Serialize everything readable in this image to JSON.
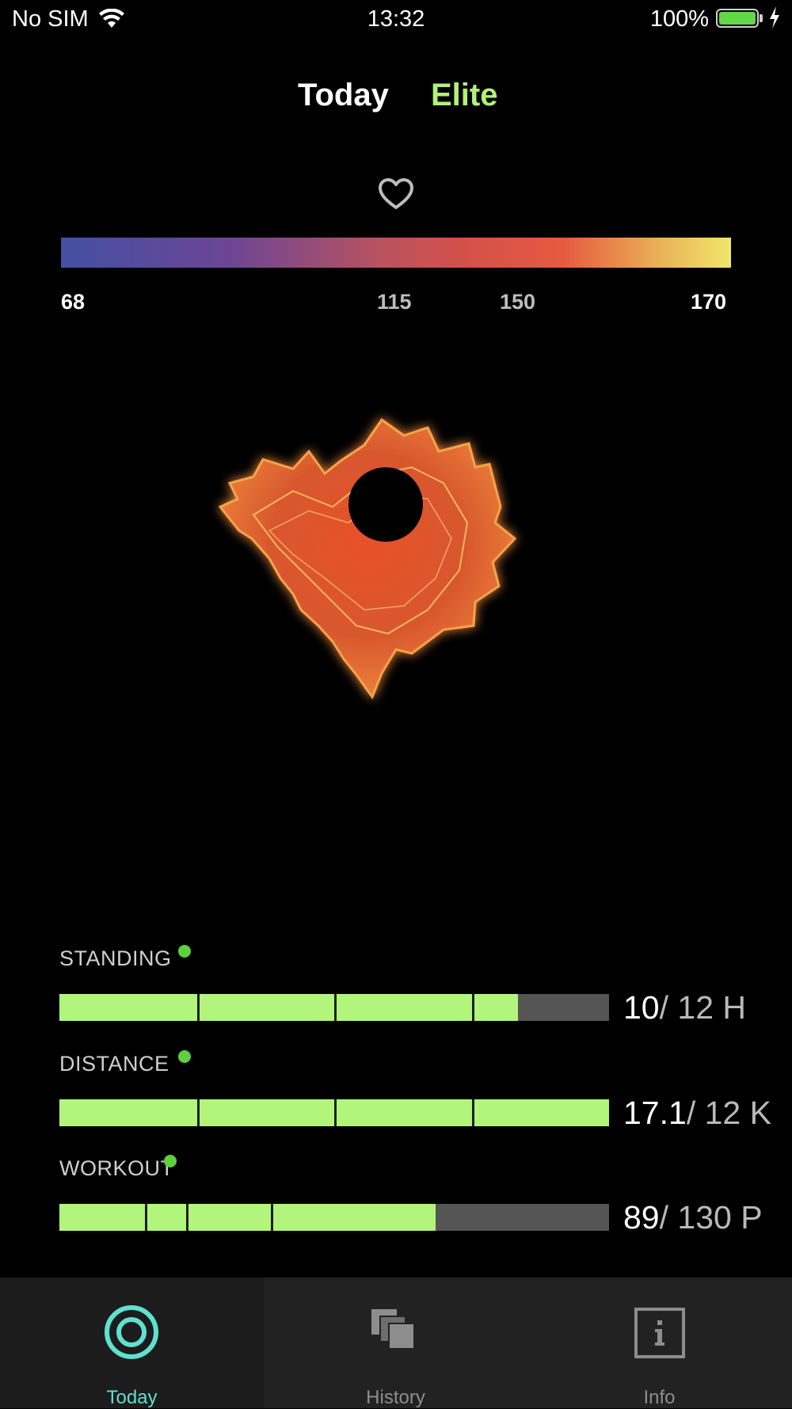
{
  "status_bar": {
    "carrier": "No SIM",
    "time": "13:32",
    "battery_percent": "100%",
    "battery_level": 1.0,
    "battery_color": "#63d64a"
  },
  "header": {
    "tabs": [
      {
        "label": "Today",
        "active": true
      },
      {
        "label": "Elite",
        "active": false,
        "color": "#b1f27a"
      }
    ]
  },
  "heart_rate_scale": {
    "icon": "heart-icon",
    "labels": [
      "68",
      "115",
      "150",
      "170"
    ],
    "gradient_colors": [
      "#4450a2",
      "#6c4595",
      "#d3504a",
      "#e65a40",
      "#f1e66d"
    ]
  },
  "metrics": [
    {
      "label": "STANDING",
      "current": "10",
      "goal": "/ 12 H",
      "fill_fraction": 0.835,
      "segments": [
        0.25,
        0.5,
        0.75
      ],
      "dot_color": "#5fcf3e"
    },
    {
      "label": "DISTANCE",
      "current": "17.1",
      "goal": "/ 12 K",
      "fill_fraction": 1.0,
      "segments": [
        0.25,
        0.5,
        0.75
      ],
      "dot_color": "#5fcf3e"
    },
    {
      "label": "WORKOUT",
      "current": "89",
      "goal": "/ 130 P",
      "fill_fraction": 0.685,
      "segments": [
        0.155,
        0.23,
        0.385
      ],
      "dot_color": "#5fcf3e"
    }
  ],
  "tab_bar": {
    "tabs": [
      {
        "label": "Today",
        "icon": "target-icon",
        "active": true
      },
      {
        "label": "History",
        "icon": "stacked-layers-icon",
        "active": false
      },
      {
        "label": "Info",
        "icon": "info-icon",
        "active": false
      }
    ],
    "accent": "#5fe0d0"
  }
}
